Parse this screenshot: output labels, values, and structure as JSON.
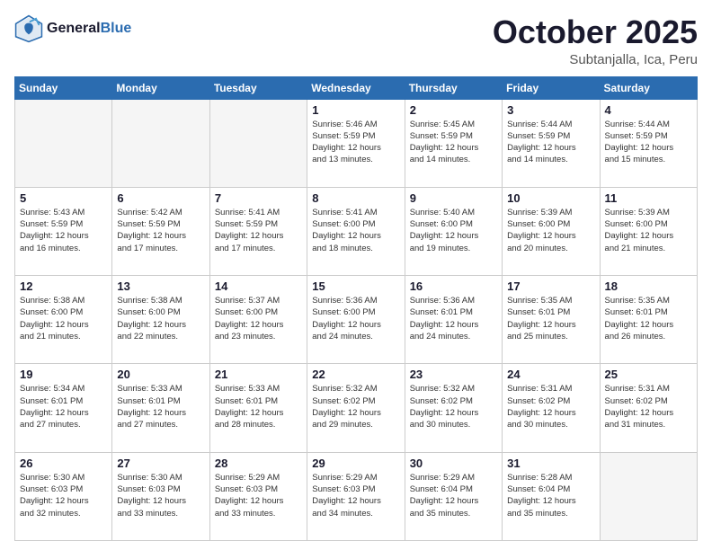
{
  "header": {
    "logo_line1": "General",
    "logo_line2": "Blue",
    "month": "October 2025",
    "location": "Subtanjalla, Ica, Peru"
  },
  "weekdays": [
    "Sunday",
    "Monday",
    "Tuesday",
    "Wednesday",
    "Thursday",
    "Friday",
    "Saturday"
  ],
  "weeks": [
    [
      {
        "day": "",
        "info": ""
      },
      {
        "day": "",
        "info": ""
      },
      {
        "day": "",
        "info": ""
      },
      {
        "day": "1",
        "info": "Sunrise: 5:46 AM\nSunset: 5:59 PM\nDaylight: 12 hours\nand 13 minutes."
      },
      {
        "day": "2",
        "info": "Sunrise: 5:45 AM\nSunset: 5:59 PM\nDaylight: 12 hours\nand 14 minutes."
      },
      {
        "day": "3",
        "info": "Sunrise: 5:44 AM\nSunset: 5:59 PM\nDaylight: 12 hours\nand 14 minutes."
      },
      {
        "day": "4",
        "info": "Sunrise: 5:44 AM\nSunset: 5:59 PM\nDaylight: 12 hours\nand 15 minutes."
      }
    ],
    [
      {
        "day": "5",
        "info": "Sunrise: 5:43 AM\nSunset: 5:59 PM\nDaylight: 12 hours\nand 16 minutes."
      },
      {
        "day": "6",
        "info": "Sunrise: 5:42 AM\nSunset: 5:59 PM\nDaylight: 12 hours\nand 17 minutes."
      },
      {
        "day": "7",
        "info": "Sunrise: 5:41 AM\nSunset: 5:59 PM\nDaylight: 12 hours\nand 17 minutes."
      },
      {
        "day": "8",
        "info": "Sunrise: 5:41 AM\nSunset: 6:00 PM\nDaylight: 12 hours\nand 18 minutes."
      },
      {
        "day": "9",
        "info": "Sunrise: 5:40 AM\nSunset: 6:00 PM\nDaylight: 12 hours\nand 19 minutes."
      },
      {
        "day": "10",
        "info": "Sunrise: 5:39 AM\nSunset: 6:00 PM\nDaylight: 12 hours\nand 20 minutes."
      },
      {
        "day": "11",
        "info": "Sunrise: 5:39 AM\nSunset: 6:00 PM\nDaylight: 12 hours\nand 21 minutes."
      }
    ],
    [
      {
        "day": "12",
        "info": "Sunrise: 5:38 AM\nSunset: 6:00 PM\nDaylight: 12 hours\nand 21 minutes."
      },
      {
        "day": "13",
        "info": "Sunrise: 5:38 AM\nSunset: 6:00 PM\nDaylight: 12 hours\nand 22 minutes."
      },
      {
        "day": "14",
        "info": "Sunrise: 5:37 AM\nSunset: 6:00 PM\nDaylight: 12 hours\nand 23 minutes."
      },
      {
        "day": "15",
        "info": "Sunrise: 5:36 AM\nSunset: 6:00 PM\nDaylight: 12 hours\nand 24 minutes."
      },
      {
        "day": "16",
        "info": "Sunrise: 5:36 AM\nSunset: 6:01 PM\nDaylight: 12 hours\nand 24 minutes."
      },
      {
        "day": "17",
        "info": "Sunrise: 5:35 AM\nSunset: 6:01 PM\nDaylight: 12 hours\nand 25 minutes."
      },
      {
        "day": "18",
        "info": "Sunrise: 5:35 AM\nSunset: 6:01 PM\nDaylight: 12 hours\nand 26 minutes."
      }
    ],
    [
      {
        "day": "19",
        "info": "Sunrise: 5:34 AM\nSunset: 6:01 PM\nDaylight: 12 hours\nand 27 minutes."
      },
      {
        "day": "20",
        "info": "Sunrise: 5:33 AM\nSunset: 6:01 PM\nDaylight: 12 hours\nand 27 minutes."
      },
      {
        "day": "21",
        "info": "Sunrise: 5:33 AM\nSunset: 6:01 PM\nDaylight: 12 hours\nand 28 minutes."
      },
      {
        "day": "22",
        "info": "Sunrise: 5:32 AM\nSunset: 6:02 PM\nDaylight: 12 hours\nand 29 minutes."
      },
      {
        "day": "23",
        "info": "Sunrise: 5:32 AM\nSunset: 6:02 PM\nDaylight: 12 hours\nand 30 minutes."
      },
      {
        "day": "24",
        "info": "Sunrise: 5:31 AM\nSunset: 6:02 PM\nDaylight: 12 hours\nand 30 minutes."
      },
      {
        "day": "25",
        "info": "Sunrise: 5:31 AM\nSunset: 6:02 PM\nDaylight: 12 hours\nand 31 minutes."
      }
    ],
    [
      {
        "day": "26",
        "info": "Sunrise: 5:30 AM\nSunset: 6:03 PM\nDaylight: 12 hours\nand 32 minutes."
      },
      {
        "day": "27",
        "info": "Sunrise: 5:30 AM\nSunset: 6:03 PM\nDaylight: 12 hours\nand 33 minutes."
      },
      {
        "day": "28",
        "info": "Sunrise: 5:29 AM\nSunset: 6:03 PM\nDaylight: 12 hours\nand 33 minutes."
      },
      {
        "day": "29",
        "info": "Sunrise: 5:29 AM\nSunset: 6:03 PM\nDaylight: 12 hours\nand 34 minutes."
      },
      {
        "day": "30",
        "info": "Sunrise: 5:29 AM\nSunset: 6:04 PM\nDaylight: 12 hours\nand 35 minutes."
      },
      {
        "day": "31",
        "info": "Sunrise: 5:28 AM\nSunset: 6:04 PM\nDaylight: 12 hours\nand 35 minutes."
      },
      {
        "day": "",
        "info": ""
      }
    ]
  ]
}
